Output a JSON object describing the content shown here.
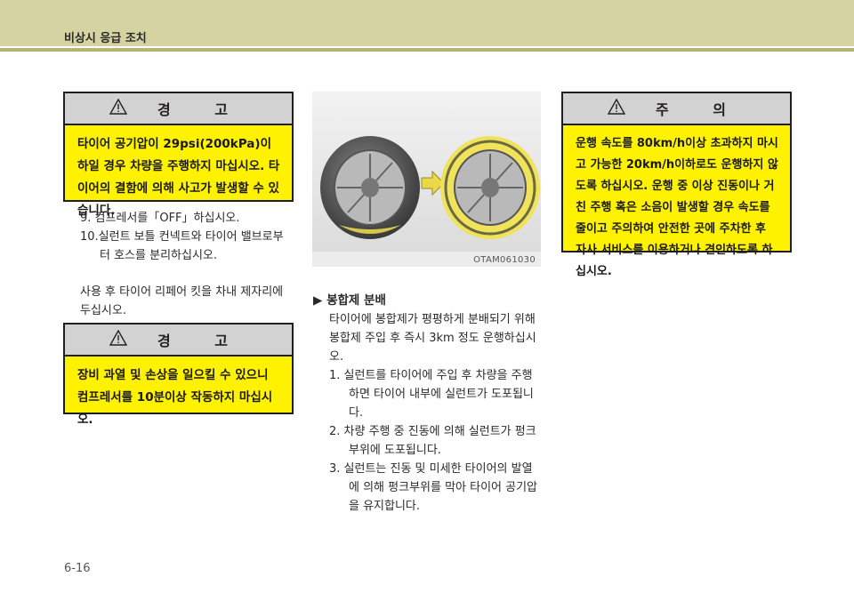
{
  "header": {
    "title": "비상시 응급 조치"
  },
  "warning1": {
    "title": "경 고",
    "body": "타이어 공기압이 29psi(200kPa)이하일 경우 차량을 주행하지 마십시오. 타이어의 결함에 의해 사고가 발생할 수 있습니다."
  },
  "steps": [
    "9. 컴프레서를「OFF」하십시오.",
    "10.실런트 보틀 컨넥트와 타이어 밸브로부터 호스를 분리하십시오."
  ],
  "after_use": "사용 후 타이어 리페어 킷을 차내 제자리에 두십시오.",
  "warning2": {
    "title": "경 고",
    "body": "장비 과열 및 손상을 일으킬 수 있으니 컴프레서를 10분이상 작동하지 마십시오."
  },
  "image": {
    "code": "OTAM061030"
  },
  "section": {
    "title": "▶ 봉합제 분배",
    "intro": "타이어에 봉합제가 평평하게 분배되기 위해 봉합제 주입 후 즉시 3km 정도 운행하십시오.",
    "items": [
      "1. 실런트를 타이어에 주입 후 차량을 주행하면 타이어 내부에 실런트가 도포됩니다.",
      "2. 차량 주행 중 진동에 의해 실런트가 펑크부위에 도포됩니다.",
      "3. 실런트는 진동 및 미세한 타이어의 발열에 의해 펑크부위를 막아 타이어 공기압을 유지합니다."
    ]
  },
  "caution": {
    "title": "주 의",
    "body": "운행 속도를 80km/h이상 초과하지 마시고 가능한 20km/h이하로도 운행하지 않도록 하십시오. 운행 중 이상 진동이나 거친 주행 혹은 소음이 발생할 경우 속도를 줄이고 주의하여 안전한 곳에 주차한 후 자사 서비스를 이용하거나 견인하도록 하십시오."
  },
  "page_number": "6-16"
}
